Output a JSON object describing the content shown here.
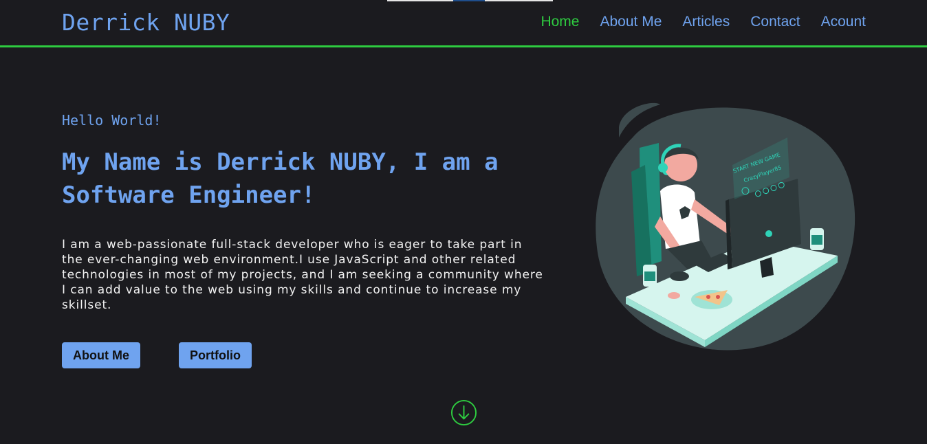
{
  "header": {
    "logo": "Derrick NUBY",
    "nav": [
      {
        "label": "Home",
        "active": true
      },
      {
        "label": "About Me",
        "active": false
      },
      {
        "label": "Articles",
        "active": false
      },
      {
        "label": "Contact",
        "active": false
      },
      {
        "label": "Acount",
        "active": false
      }
    ]
  },
  "hero": {
    "greeting": "Hello World!",
    "headline": "My Name is Derrick NUBY, I am a Software Engineer!",
    "intro": "I am a web-passionate full-stack developer who is eager to take part in the ever-changing web environment.I use JavaScript and other related technologies in most of my projects, and I am seeking a community where I can add value to the web using my skills and continue to increase my skillset.",
    "buttons": {
      "about": "About Me",
      "portfolio": "Portfolio"
    }
  },
  "illustration": {
    "screen_title": "START NEW GAME",
    "player": "CrazyPlayer85"
  },
  "icons": {
    "scroll": "arrow-down-circle-icon"
  },
  "colors": {
    "accent": "#6fa3ef",
    "active": "#2ecc40",
    "background": "#1b1b1f"
  }
}
